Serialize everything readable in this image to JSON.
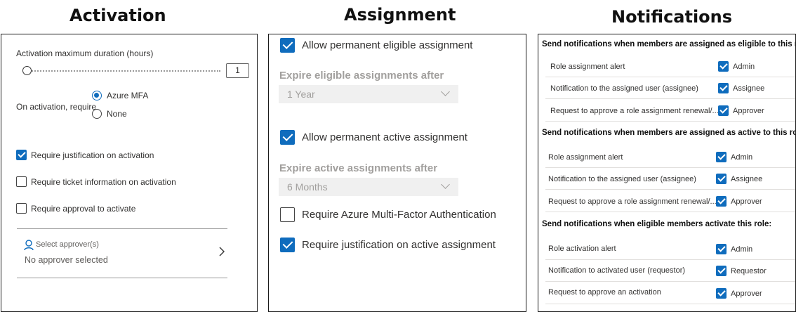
{
  "headings": {
    "activation": "Activation",
    "assignment": "Assignment",
    "notifications": "Notifications"
  },
  "activation": {
    "max_duration_label": "Activation maximum duration (hours)",
    "max_duration_value": "1",
    "slider_level": 0.0,
    "require_label": "On activation, require",
    "options": [
      {
        "label": "Azure MFA",
        "selected": true
      },
      {
        "label": "None",
        "selected": false
      }
    ],
    "checkboxes": [
      {
        "label": "Require justification on activation",
        "checked": true
      },
      {
        "label": "Require ticket information on activation",
        "checked": false
      },
      {
        "label": "Require approval to activate",
        "checked": false
      }
    ],
    "approver": {
      "label": "Select approver(s)",
      "value": "No approver selected",
      "icon": "person-icon"
    }
  },
  "assignment": {
    "allow_permanent_eligible": {
      "label": "Allow permanent eligible assignment",
      "checked": true
    },
    "expire_eligible_label": "Expire eligible assignments after",
    "expire_eligible_value": "1 Year",
    "allow_permanent_active": {
      "label": "Allow permanent active assignment",
      "checked": true
    },
    "expire_active_label": "Expire active assignments after",
    "expire_active_value": "6 Months",
    "require_mfa": {
      "label": "Require Azure Multi-Factor Authentication",
      "checked": false
    },
    "require_justification": {
      "label": "Require justification on active assignment",
      "checked": true
    }
  },
  "notifications": {
    "sections": [
      {
        "title": "Send notifications when members are assigned as eligible to this role:",
        "rows": [
          {
            "label": "Role assignment alert",
            "recipient": "Admin",
            "checked": true
          },
          {
            "label": "Notification to the assigned user (assignee)",
            "recipient": "Assignee",
            "checked": true
          },
          {
            "label": "Request to approve a role assignment renewal/...",
            "recipient": "Approver",
            "checked": true
          }
        ]
      },
      {
        "title": "Send notifications when members are assigned as active to this role:",
        "rows": [
          {
            "label": "Role assignment alert",
            "recipient": "Admin",
            "checked": true
          },
          {
            "label": "Notification to the assigned user (assignee)",
            "recipient": "Assignee",
            "checked": true
          },
          {
            "label": "Request to approve a role assignment renewal/...",
            "recipient": "Approver",
            "checked": true
          }
        ]
      },
      {
        "title": "Send notifications when eligible members activate this role:",
        "rows": [
          {
            "label": "Role activation alert",
            "recipient": "Admin",
            "checked": true
          },
          {
            "label": "Notification to activated user (requestor)",
            "recipient": "Requestor",
            "checked": true
          },
          {
            "label": "Request to approve an activation",
            "recipient": "Approver",
            "checked": true
          }
        ]
      }
    ]
  },
  "colors": {
    "accent": "#0f6cbd",
    "disabled_text": "#a19f9d",
    "dropdown_bg": "#f0f0f0"
  }
}
